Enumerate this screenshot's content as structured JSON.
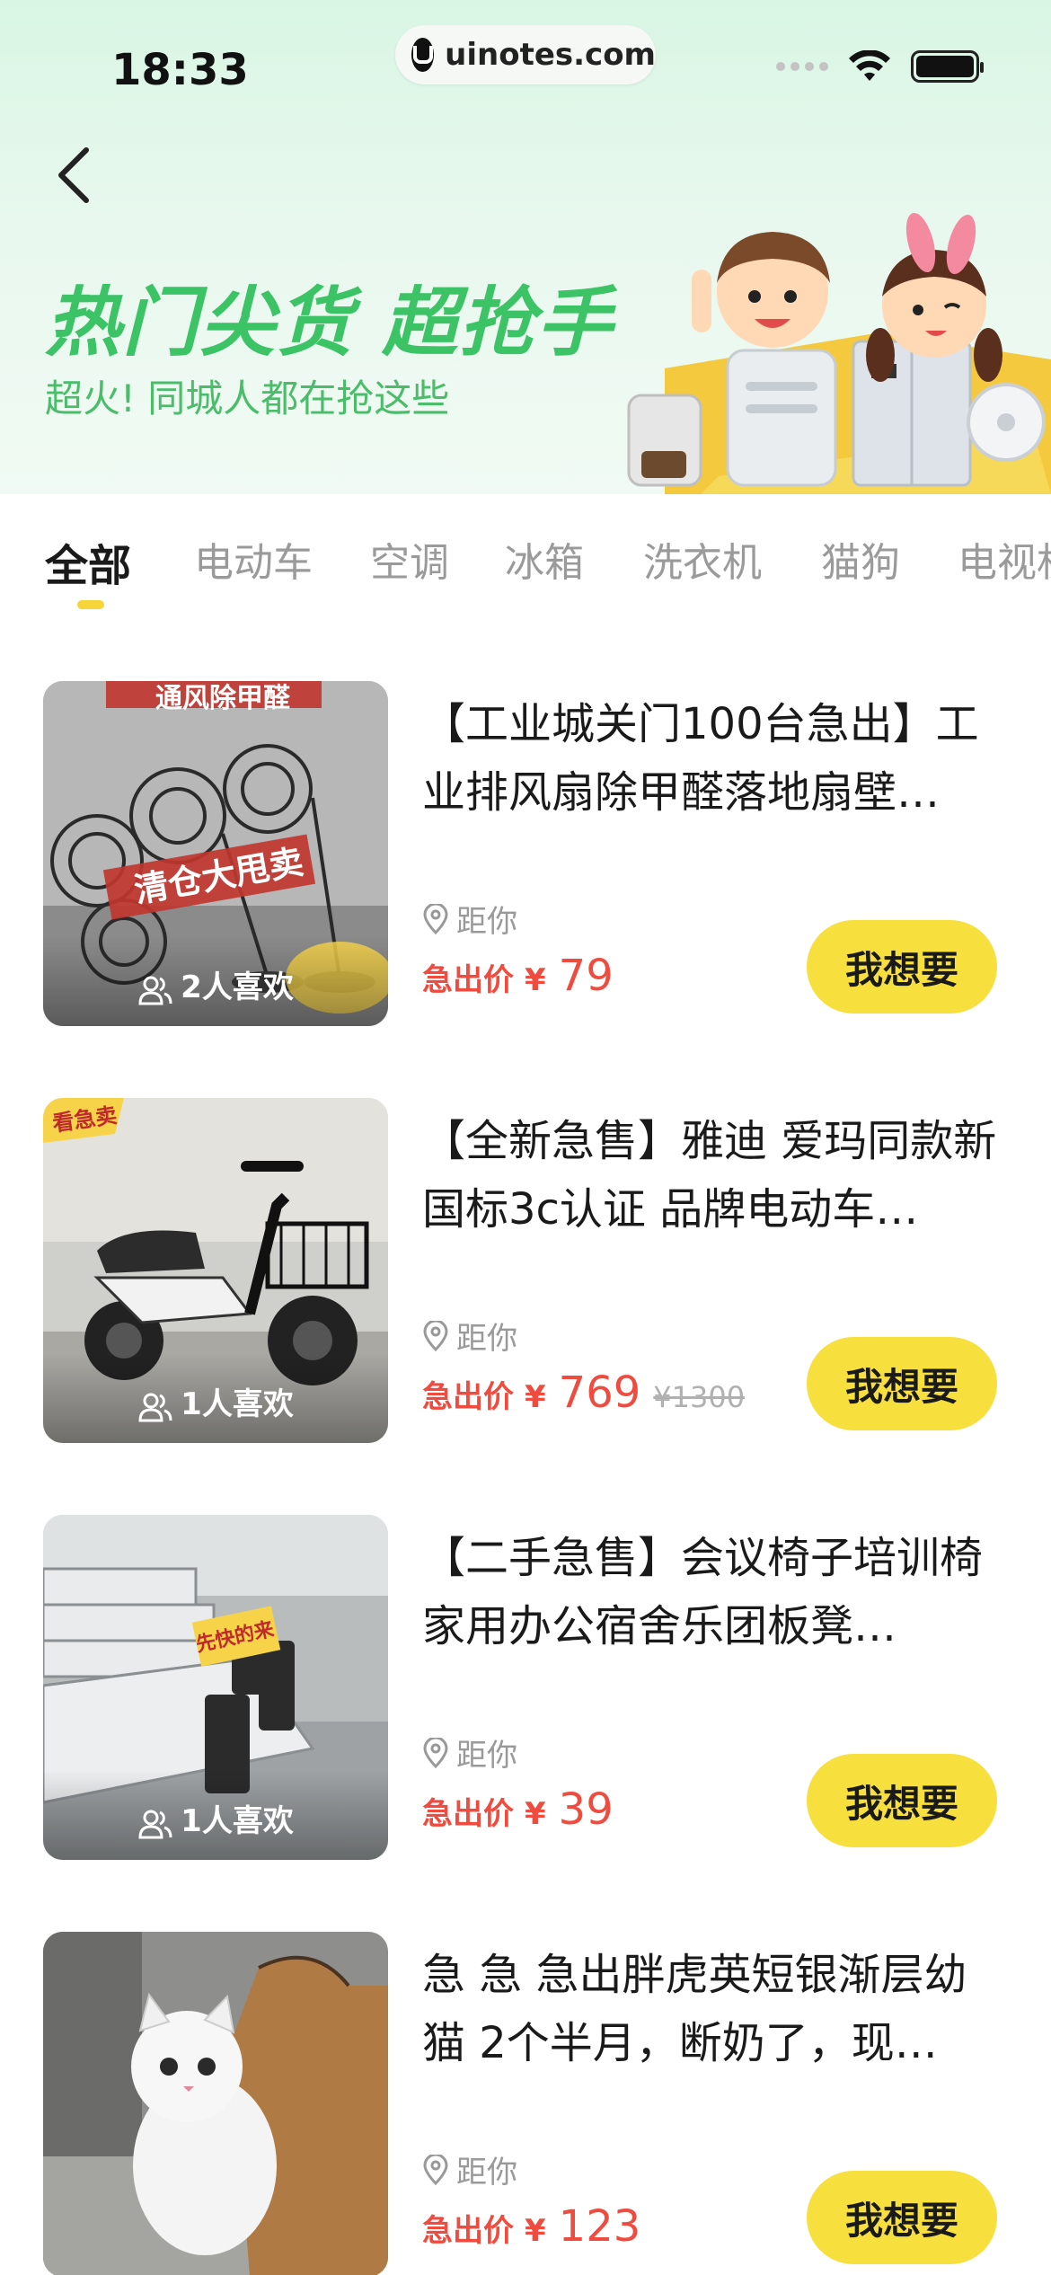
{
  "status_bar": {
    "time": "18:33",
    "url": "uinotes.com"
  },
  "hero": {
    "title": "热门尖货 超抢手",
    "subtitle": "超火! 同城人都在抢这些"
  },
  "tabs": [
    {
      "label": "全部",
      "active": true
    },
    {
      "label": "电动车"
    },
    {
      "label": "空调"
    },
    {
      "label": "冰箱"
    },
    {
      "label": "洗衣机"
    },
    {
      "label": "猫狗"
    },
    {
      "label": "电视机"
    }
  ],
  "items": [
    {
      "title": "【工业城关门100台急出】工业排风扇除甲醛落地扇壁…",
      "likes": "2人喜欢",
      "distance": "距你",
      "price_label": "急出价",
      "currency": "¥",
      "price": "79",
      "original_price": "",
      "button": "我想要",
      "thumb_overlay_text": "清仓大甩卖",
      "thumb_top_text": "通风除甲醛"
    },
    {
      "title": "【全新急售】雅迪 爱玛同款新国标3c认证 品牌电动车…",
      "likes": "1人喜欢",
      "distance": "距你",
      "price_label": "急出价",
      "currency": "¥",
      "price": "769",
      "original_price": "¥1300",
      "button": "我想要",
      "thumb_tag": "看急卖"
    },
    {
      "title": "【二手急售】会议椅子培训椅家用办公宿舍乐团板凳…",
      "likes": "1人喜欢",
      "distance": "距你",
      "price_label": "急出价",
      "currency": "¥",
      "price": "39",
      "original_price": "",
      "button": "我想要",
      "thumb_sign": "先快的来"
    },
    {
      "title": "急 急 急出胖虎英短银渐层幼猫 2个半月，断奶了，现…",
      "likes": "",
      "distance": "距你",
      "price_label": "急出价",
      "currency": "¥",
      "price": "123",
      "original_price": "",
      "button": "我想要"
    }
  ],
  "colors": {
    "accent_green": "#3cc366",
    "price_red": "#ef4b3f",
    "button_yellow": "#f7df3e"
  }
}
